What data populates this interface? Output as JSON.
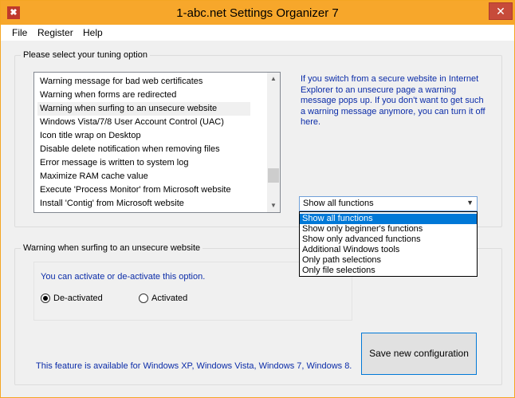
{
  "window": {
    "title": "1-abc.net Settings Organizer 7",
    "close_glyph": "✕",
    "app_icon_glyph": "✖"
  },
  "menu": [
    {
      "label": "File"
    },
    {
      "label": "Register"
    },
    {
      "label": "Help"
    }
  ],
  "tuning": {
    "group_label": "Please select your tuning option",
    "items": [
      "Warning message for bad web certificates",
      "Warning when forms are redirected",
      "Warning when surfing to an unsecure website",
      "Windows Vista/7/8 User Account Control (UAC)",
      "Icon title wrap on Desktop",
      "Disable delete notification when removing files",
      "Error message is written to system log",
      "Maximize RAM cache value",
      "Execute 'Process Monitor' from Microsoft website",
      "Install 'Contig' from Microsoft website"
    ],
    "selected_index": 2,
    "info": "If you switch from a secure website in Internet Explorer to an unsecure page a warning message pops up. If you don't want to get such a warning message anymore, you can turn it off here."
  },
  "filter": {
    "selected": "Show all functions",
    "options": [
      "Show all functions",
      "Show only beginner's functions",
      "Show only advanced functions",
      "Additional Windows tools",
      "Only path selections",
      "Only file selections"
    ]
  },
  "detail": {
    "group_label": "Warning when surfing to an unsecure website",
    "instruction": "You can activate or de-activate this option.",
    "radio_deactivated": "De-activated",
    "radio_activated": "Activated",
    "availability": "This feature is available for Windows XP, Windows Vista, Windows 7, Windows 8.",
    "save_label": "Save new configuration"
  },
  "colors": {
    "title_bar": "#f7a72b",
    "accent_text": "#0b2ca8",
    "selection": "#0078d7"
  }
}
